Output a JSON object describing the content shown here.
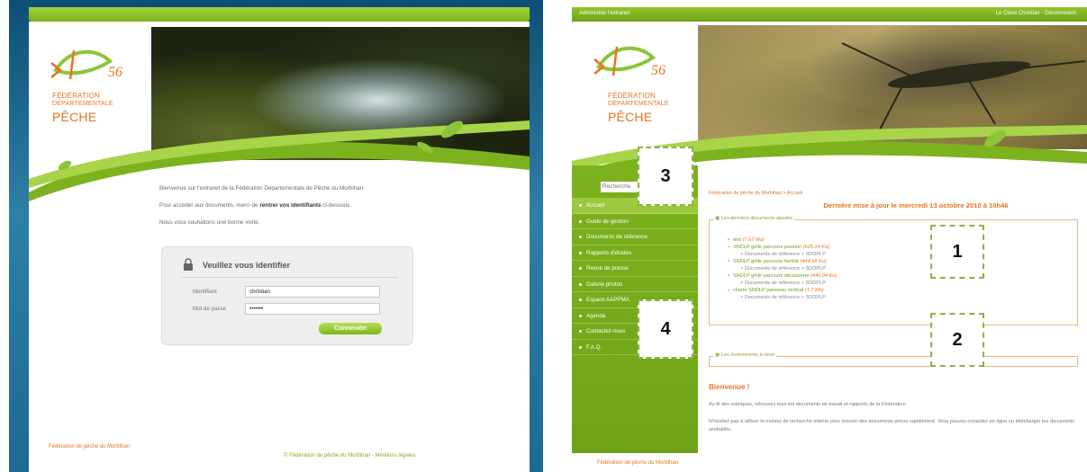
{
  "login_page": {
    "logo": {
      "number": "56",
      "line1": "FÉDÉRATION",
      "line2": "DÉPARTEMENTALE",
      "line3": "PÊCHE"
    },
    "intro": {
      "welcome": "Bienvenue sur l'extranet de la Fédération Départementale de Pêche du Morbihan.",
      "access_prefix": "Pour accéder aux documents, merci de ",
      "access_bold": "rentrer vos identifiants",
      "access_suffix": " ci-dessous.",
      "wish": "Nous vous souhaitons une bonne visite."
    },
    "login_box": {
      "title": "Veuillez vous identifier",
      "username_label": "Identifiant",
      "username_value": "christian",
      "password_label": "Mot de passe",
      "password_value": "•••••••",
      "submit_label": "Connexion"
    },
    "footer": {
      "left": "Fédération de pêche du Morbihan",
      "right": "© Fédération de pêche du Morbihan - Mentions légales"
    }
  },
  "extranet_page": {
    "admin_bar": {
      "admin_link": "Administrer l'extranet",
      "user_link": "Le Clève Christian - Déconnexion"
    },
    "logo": {
      "number": "56",
      "line1": "FÉDÉRATION",
      "line2": "DÉPARTEMENTALE",
      "line3": "PÊCHE"
    },
    "search_placeholder": "Recherche",
    "menu": [
      "Accueil",
      "Guide de gestion",
      "Documents de référence",
      "Rapports d'études",
      "Revue de presse",
      "Galerie photos",
      "Espace AAPPMA",
      "Agenda",
      "Contactez-nous",
      "F.A.Q."
    ],
    "breadcrumb": "Fédération de pêche du Morbihan > Accueil",
    "last_update": "Dernière mise à jour le mercredi 13 octobre 2010 à 10h46",
    "documents_legend": "Les derniers documents ajoutés",
    "documents": [
      {
        "name": "test",
        "size": "(7.67 Mo)",
        "path": ""
      },
      {
        "name": "SNDLP grille parcours passion",
        "size": "(625.14 Ko)",
        "path": "> Documents de référence > SDDPLP"
      },
      {
        "name": "SNDLP grille parcours famille",
        "size": "(444.68 Ko)",
        "path": "> Documents de référence > SDDPLP"
      },
      {
        "name": "SNDLP grille parcours découverte",
        "size": "(446.04 Ko)",
        "path": "> Documents de référence > SDDPLP"
      },
      {
        "name": "charte SNDLP panneau vertical",
        "size": "(1.7 Mo)",
        "path": "> Documents de référence > SDDPLP"
      }
    ],
    "events_legend": "Les événements à venir",
    "welcome_title": "Bienvenue !",
    "paragraph1": "Au fil des rubriques, retrouvez tous les documents de travail et rapports de la Fédération.",
    "paragraph2": "N'hésitez pas à utiliser le moteur de recherche interne pour trouver des documents précis rapidement. Vous pouvez consulter en ligne ou télécharger les documents souhaités.",
    "footer": {
      "left": "Fédération de pêche du Morbihan",
      "right": "© Fédération de pêche du Morbihan - Mentions légales"
    }
  },
  "markers": [
    "1",
    "2",
    "3",
    "4"
  ],
  "colors": {
    "green": "#7cb21d",
    "orange": "#e4741f",
    "blue": "#1d6a92"
  }
}
